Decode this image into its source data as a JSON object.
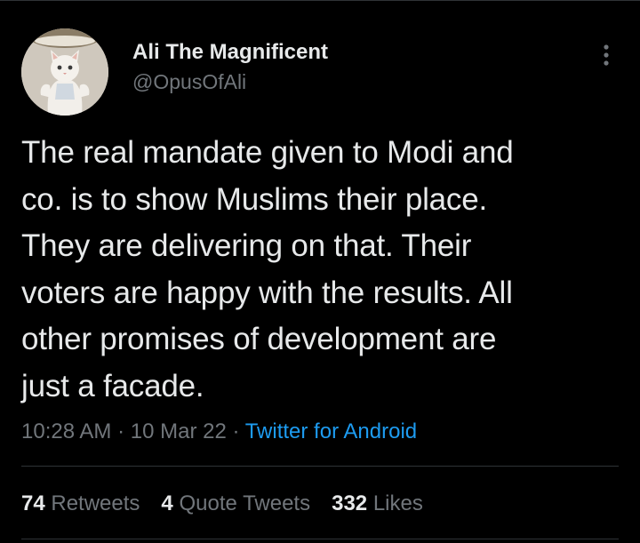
{
  "author": {
    "display_name": "Ali The Magnificent",
    "handle": "@OpusOfAli",
    "avatar_icon": "cat-avatar"
  },
  "more_icon": "more-dots-icon",
  "tweet": {
    "lines": [
      "The real mandate given to Modi and",
      "co. is to show Muslims their place.",
      "They are delivering on that. Their",
      "voters are happy with the results. All",
      "other promises of development are",
      "just a facade."
    ]
  },
  "meta": {
    "time": "10:28 AM",
    "separator": " · ",
    "date": "10 Mar 22",
    "source": "Twitter for Android"
  },
  "stats": {
    "retweets_count": "74",
    "retweets_label": "Retweets",
    "quotes_count": "4",
    "quotes_label": "Quote Tweets",
    "likes_count": "332",
    "likes_label": "Likes"
  },
  "colors": {
    "background": "#000000",
    "text_primary": "#e7e9ea",
    "text_secondary": "#71767b",
    "link": "#1d9bf0",
    "divider": "#2f3336"
  }
}
